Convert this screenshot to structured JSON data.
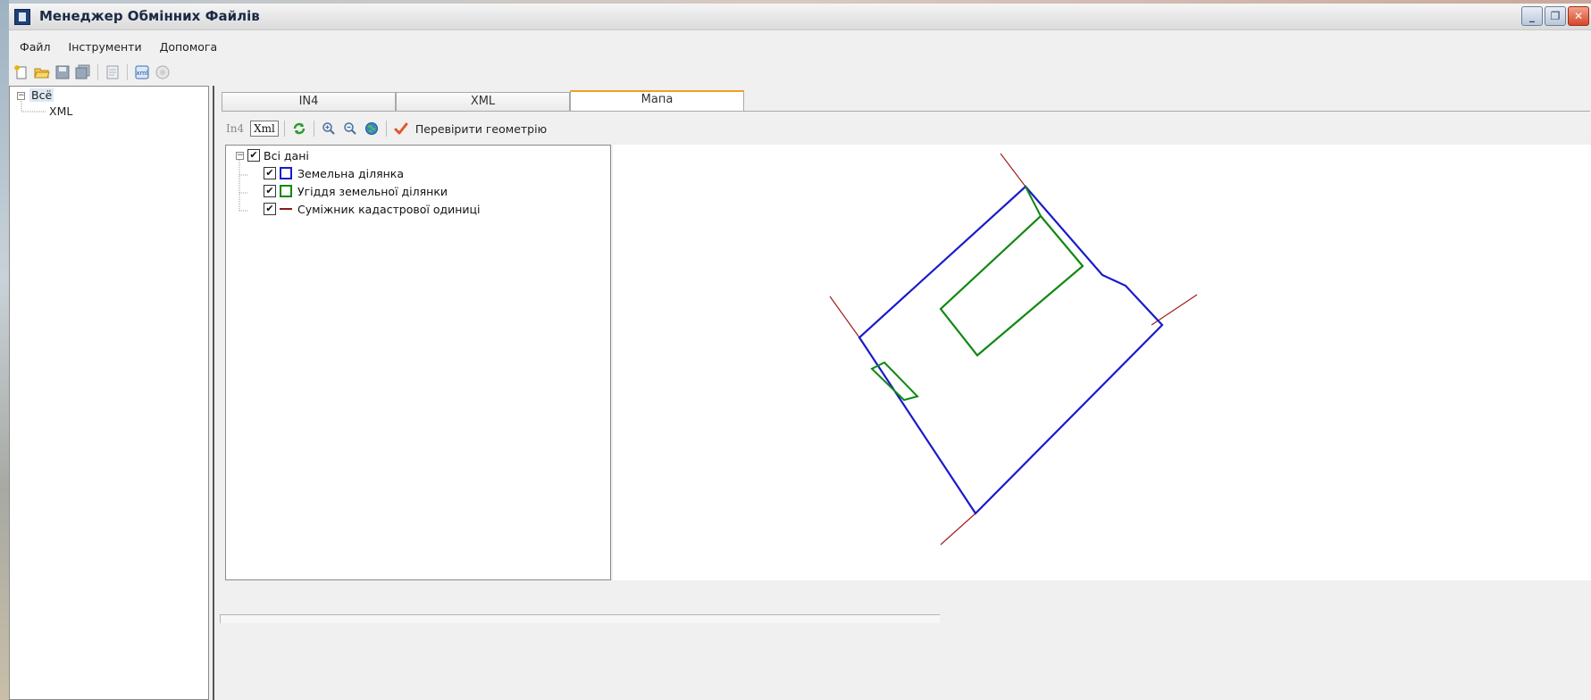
{
  "window": {
    "title": "Менеджер Обмінних Файлів",
    "controls": {
      "minimize": "_",
      "maximize": "❐",
      "close": "✕"
    }
  },
  "menu": [
    "Файл",
    "Інструменти",
    "Допомога"
  ],
  "toolbar": [
    "new-file-icon",
    "open-folder-icon",
    "save-icon",
    "save-all-icon",
    "document-icon",
    "export-xml-icon",
    "import-icon"
  ],
  "tree": {
    "root": "Всё",
    "child": "XML"
  },
  "tabs": [
    {
      "label": "IN4",
      "active": false
    },
    {
      "label": "XML",
      "active": false
    },
    {
      "label": "Мапа",
      "active": true
    }
  ],
  "map_toolbar": {
    "in4": "In4",
    "xml": "Xml",
    "check_geometry": "Перевірити геометрію",
    "icons": [
      "refresh-icon",
      "zoom-in-icon",
      "zoom-out-icon",
      "globe-icon",
      "checkmark-icon"
    ]
  },
  "layers": {
    "root": "Всі дані",
    "items": [
      {
        "label": "Земельна ділянка",
        "checked": true,
        "symbol": "square",
        "color": "#1a1acc"
      },
      {
        "label": "Угіддя земельної ділянки",
        "checked": true,
        "symbol": "square",
        "color": "#118811"
      },
      {
        "label": "Суміжник кадастрової одиниці",
        "checked": true,
        "symbol": "line",
        "color": "#8b1a1a"
      }
    ]
  },
  "colors": {
    "parcel": "#1a1acc",
    "land_use": "#118811",
    "adjacent": "#a02020",
    "active_tab_accent": "#f0a020"
  }
}
